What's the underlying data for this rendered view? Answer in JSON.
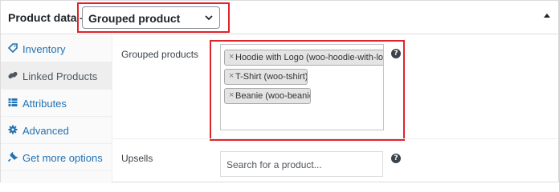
{
  "header": {
    "title": "Product data —",
    "product_type": {
      "selected": "Grouped product",
      "icon": "chevron-down-icon"
    },
    "toggle_icon": "caret-up-icon"
  },
  "sidebar": {
    "items": [
      {
        "label": "Inventory",
        "icon": "tag-icon",
        "active": false
      },
      {
        "label": "Linked Products",
        "icon": "link-icon",
        "active": true
      },
      {
        "label": "Attributes",
        "icon": "table-icon",
        "active": false
      },
      {
        "label": "Advanced",
        "icon": "gear-icon",
        "active": false
      },
      {
        "label": "Get more options",
        "icon": "plugin-icon",
        "active": false
      }
    ]
  },
  "main": {
    "grouped_products": {
      "label": "Grouped products",
      "help": "?",
      "selected": [
        {
          "remove": "×",
          "text": "Hoodie with Logo (woo-hoodie-with-logo)"
        },
        {
          "remove": "×",
          "text": "T-Shirt (woo-tshirt)"
        },
        {
          "remove": "×",
          "text": "Beanie (woo-beanie)"
        }
      ]
    },
    "upsells": {
      "label": "Upsells",
      "help": "?",
      "placeholder": "Search for a product..."
    }
  },
  "colors": {
    "highlight": "#e0242b",
    "link": "#2271b1",
    "active_tab_bg": "#eeeeee",
    "sidebar_bg": "#fafafa"
  }
}
